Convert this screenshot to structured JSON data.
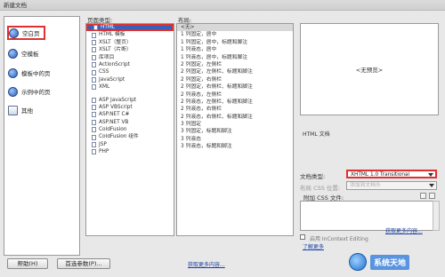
{
  "window": {
    "title": "新建文档"
  },
  "categories": [
    {
      "label": "空白页",
      "icon": "globe-icon",
      "selected": true
    },
    {
      "label": "空模板",
      "icon": "globe-icon",
      "selected": false
    },
    {
      "label": "模板中的页",
      "icon": "globe-icon",
      "selected": false
    },
    {
      "label": "示例中的页",
      "icon": "globe-icon",
      "selected": false
    },
    {
      "label": "其他",
      "icon": "document-icon",
      "selected": false
    }
  ],
  "page_types": {
    "label": "页面类型:",
    "items": [
      {
        "label": "HTML",
        "selected": true
      },
      {
        "label": "HTML 模板",
        "selected": false
      },
      {
        "label": "XSLT（整页）",
        "selected": false
      },
      {
        "label": "XSLT（片断）",
        "selected": false
      },
      {
        "label": "库项目",
        "selected": false
      },
      {
        "label": "ActionScript",
        "selected": false
      },
      {
        "label": "CSS",
        "selected": false
      },
      {
        "label": "JavaScript",
        "selected": false
      },
      {
        "label": "XML",
        "selected": false
      },
      {
        "label": "",
        "selected": false
      },
      {
        "label": "ASP JavaScript",
        "selected": false
      },
      {
        "label": "ASP VBScript",
        "selected": false
      },
      {
        "label": "ASP.NET C#",
        "selected": false
      },
      {
        "label": "ASP.NET VB",
        "selected": false
      },
      {
        "label": "ColdFusion",
        "selected": false
      },
      {
        "label": "ColdFusion 组件",
        "selected": false
      },
      {
        "label": "JSP",
        "selected": false
      },
      {
        "label": "PHP",
        "selected": false
      }
    ]
  },
  "layouts": {
    "label": "布局:",
    "items": [
      {
        "label": "<无>",
        "selected": true
      },
      {
        "label": "1 列固定，居中",
        "selected": false
      },
      {
        "label": "1 列固定，居中，标题和脚注",
        "selected": false
      },
      {
        "label": "1 列液态，居中",
        "selected": false
      },
      {
        "label": "1 列液态，居中，标题和脚注",
        "selected": false
      },
      {
        "label": "2 列固定，左侧栏",
        "selected": false
      },
      {
        "label": "2 列固定，左侧栏、标题和脚注",
        "selected": false
      },
      {
        "label": "2 列固定，右侧栏",
        "selected": false
      },
      {
        "label": "2 列固定，右侧栏、标题和脚注",
        "selected": false
      },
      {
        "label": "2 列液态，左侧栏",
        "selected": false
      },
      {
        "label": "2 列液态，左侧栏、标题和脚注",
        "selected": false
      },
      {
        "label": "2 列液态，右侧栏",
        "selected": false
      },
      {
        "label": "2 列液态，右侧栏、标题和脚注",
        "selected": false
      },
      {
        "label": "3 列固定",
        "selected": false
      },
      {
        "label": "3 列固定，标题和脚注",
        "selected": false
      },
      {
        "label": "3 列液态",
        "selected": false
      },
      {
        "label": "3 列液态，标题和脚注",
        "selected": false
      }
    ]
  },
  "preview": {
    "placeholder": "<无预览>",
    "caption": "HTML 文档"
  },
  "doctype": {
    "label": "文档类型:",
    "value": "XHTML 1.0 Transitional"
  },
  "layout_css": {
    "label": "布局 CSS 位置:",
    "value": "添加到文档头"
  },
  "attach_css": {
    "label": "附加 CSS 文件:"
  },
  "links": {
    "more_content": "获取更多内容...",
    "learn_more": "了解更多",
    "enable_incontext": "启用 InContext Editing"
  },
  "buttons": {
    "help": "帮助(H)",
    "preferences": "首选参数(P)..."
  },
  "watermark": {
    "text": "系统天地"
  }
}
